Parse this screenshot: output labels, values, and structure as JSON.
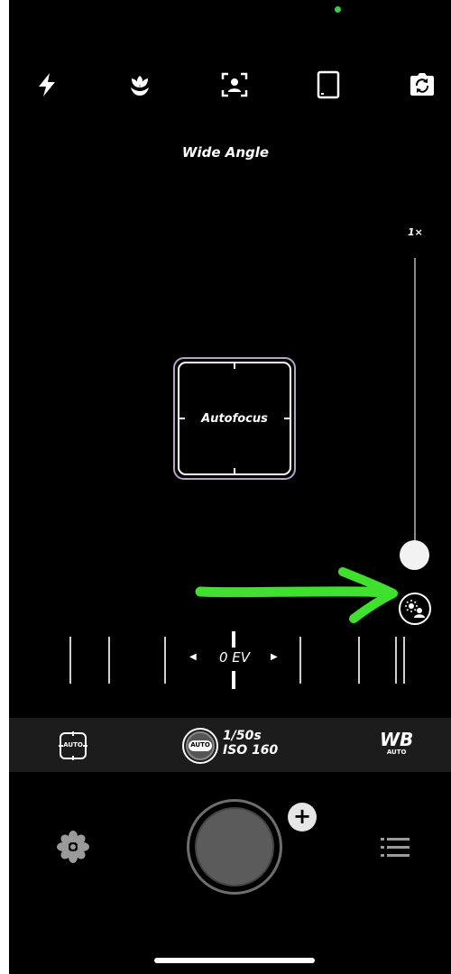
{
  "top_bar": {
    "icons": [
      "flash-icon",
      "macro-icon",
      "portrait-icon",
      "aspect-ratio-icon",
      "flip-camera-icon"
    ]
  },
  "lens": {
    "label": "Wide Angle"
  },
  "zoom": {
    "label": "1×",
    "level": 0
  },
  "focus": {
    "label": "Autofocus"
  },
  "ev": {
    "label": "0 EV"
  },
  "settings": {
    "focus_mode_badge": "AUTO",
    "exposure_badge": "AUTO",
    "shutter_speed": "1/50s",
    "iso": "ISO 160",
    "wb_label": "WB",
    "wb_mode": "AUTO"
  },
  "colors": {
    "background": "#000000",
    "focus_frame": "#b8a2cc",
    "annotation_arrow": "#3fe02e",
    "indicator_dot": "#33d04b"
  }
}
